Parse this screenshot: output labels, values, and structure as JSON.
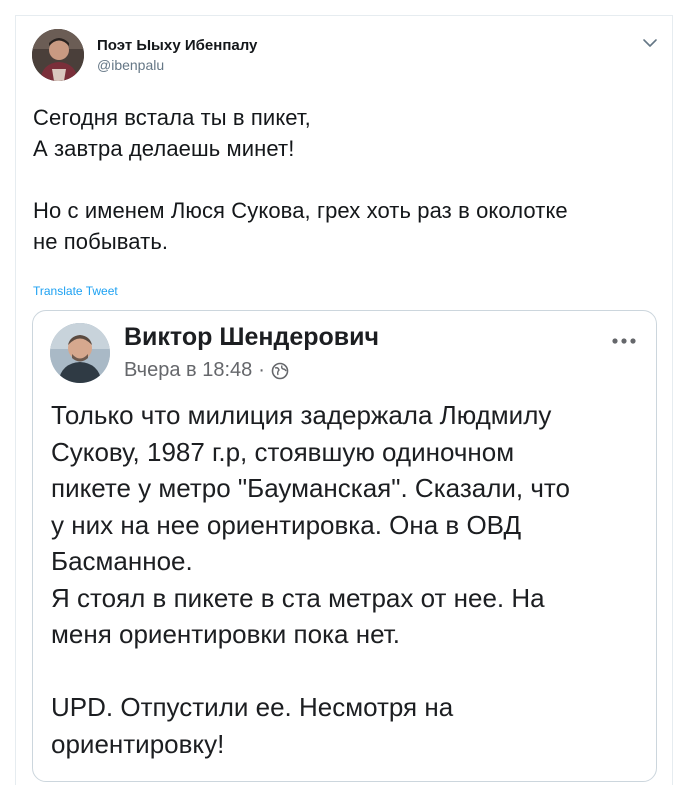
{
  "tweet": {
    "display_name": "Поэт Ыыху Ибенпалу",
    "handle": "@ibenpalu",
    "lines": [
      "Сегодня встала ты в пикет,",
      "А завтра делаешь минет!",
      "",
      "Но с именем Люся Сукова, грех хоть раз в околотке",
      "не побывать."
    ],
    "translate_label": "Translate Tweet",
    "caret_icon": "chevron-down-icon"
  },
  "embedded_post": {
    "author": "Виктор Шендерович",
    "time": "Вчера в 18:48",
    "separator": "·",
    "visibility_icon": "globe-icon",
    "more_icon": "more-horizontal-icon",
    "lines": [
      "Только что милиция задержала Людмилу",
      "Сукову, 1987 г.р, стоявшую одиночном",
      "пикете у метро \"Бауманская\". Сказали, что",
      "у них на нее ориентировка. Она в ОВД",
      "Басманное.",
      "Я стоял в пикете в ста метрах от нее. На",
      "меня ориентировки пока нет.",
      "",
      "UPD. Отпустили ее. Несмотря на",
      "ориентировку!"
    ]
  },
  "colors": {
    "link": "#1da1f2",
    "secondary_text": "#657786",
    "border": "#e6ecf0",
    "embed_border": "#ccd6dd"
  }
}
